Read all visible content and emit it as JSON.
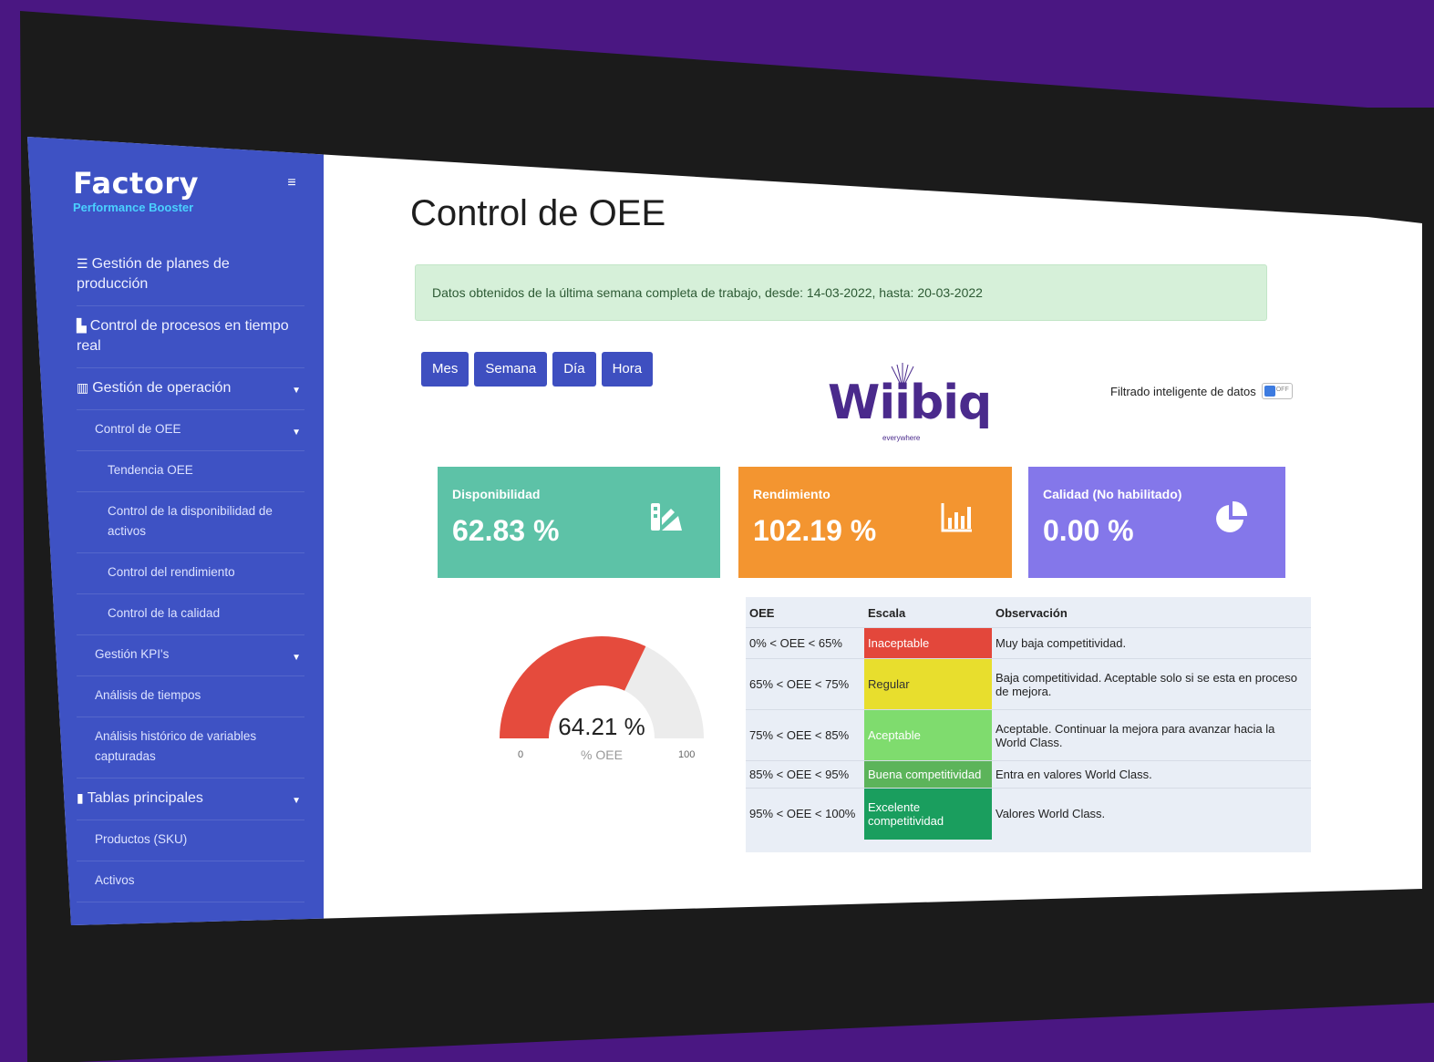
{
  "sidebar": {
    "brand_title": "Factory",
    "brand_subtitle": "Performance Booster",
    "toggle_glyph": "≡",
    "items": [
      {
        "icon": "list",
        "label": "Gestión de planes de producción",
        "level": 0
      },
      {
        "icon": "area-chart",
        "label": "Control de procesos en tiempo real",
        "level": 0
      },
      {
        "icon": "bar-chart",
        "label": "Gestión de operación",
        "level": 0,
        "caret": true
      },
      {
        "label": "Control de OEE",
        "level": 1,
        "caret": true
      },
      {
        "label": "Tendencia OEE",
        "level": 2
      },
      {
        "label": "Control de la disponibilidad de activos",
        "level": 2
      },
      {
        "label": "Control del rendimiento",
        "level": 2
      },
      {
        "label": "Control de la calidad",
        "level": 2
      },
      {
        "label": "Gestión KPI's",
        "level": 1,
        "caret": true
      },
      {
        "label": "Análisis de tiempos",
        "level": 1
      },
      {
        "label": "Análisis histórico de variables capturadas",
        "level": 1
      },
      {
        "icon": "clipboard",
        "label": "Tablas principales",
        "level": 0,
        "caret": true
      },
      {
        "label": "Productos (SKU)",
        "level": 1
      },
      {
        "label": "Activos",
        "level": 1
      }
    ]
  },
  "main": {
    "title": "Control de OEE",
    "alert": "Datos obtenidos de la última semana completa de trabajo, desde: 14-03-2022, hasta: 20-03-2022",
    "buttons": [
      "Mes",
      "Semana",
      "Día",
      "Hora"
    ],
    "logo_text": "Wiibiq",
    "logo_tag": "everywhere",
    "filter_label": "Filtrado inteligente de datos",
    "switch_label": "OFF"
  },
  "cards": [
    {
      "title": "Disponibilidad",
      "value": "62.83 %",
      "color": "#5dc2a7",
      "icon": "palette-icon"
    },
    {
      "title": "Rendimiento",
      "value": "102.19 %",
      "color": "#f39530",
      "icon": "bar-chart-icon"
    },
    {
      "title": "Calidad (No habilitado)",
      "value": "0.00 %",
      "color": "#8477ea",
      "icon": "pie-chart-icon"
    }
  ],
  "gauge": {
    "value_text": "64.21 %",
    "value": 64.21,
    "label": "% OEE",
    "min": "0",
    "max": "100",
    "fill_color": "#e54b3d",
    "track_color": "#ececec"
  },
  "oee_table": {
    "headers": [
      "OEE",
      "Escala",
      "Observación"
    ],
    "rows": [
      {
        "range": "0% < OEE < 65%",
        "scale": "Inaceptable",
        "color": "#e3473b",
        "obs": "Muy baja competitividad."
      },
      {
        "range": "65% < OEE < 75%",
        "scale": "Regular",
        "color": "#e8de2d",
        "obs": "Baja competitividad. Aceptable solo si se esta en proceso de mejora."
      },
      {
        "range": "75% < OEE < 85%",
        "scale": "Aceptable",
        "color": "#7fdc6e",
        "obs": "Aceptable. Continuar la mejora para avanzar hacia la World Class."
      },
      {
        "range": "85% < OEE < 95%",
        "scale": "Buena competitividad",
        "color": "#5cb45a",
        "obs": "Entra en valores World Class."
      },
      {
        "range": "95% < OEE < 100%",
        "scale": "Excelente competitividad",
        "color": "#1a9e5e",
        "obs": "Valores World Class."
      }
    ]
  }
}
